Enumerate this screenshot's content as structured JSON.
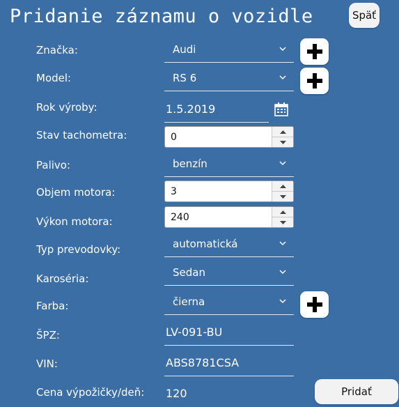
{
  "window": {
    "title": "Pridanie záznamu o vozidle",
    "back_label": "Späť"
  },
  "form": {
    "brand": {
      "label": "Značka:",
      "value": "Audi"
    },
    "model": {
      "label": "Model:",
      "value": "RS 6"
    },
    "year": {
      "label": "Rok výroby:",
      "value": "1.5.2019"
    },
    "odometer": {
      "label": "Stav tachometra:",
      "value": "0"
    },
    "fuel": {
      "label": "Palivo:",
      "value": "benzín"
    },
    "engine_volume": {
      "label": "Objem motora:",
      "value": "3"
    },
    "engine_power": {
      "label": "Výkon motora:",
      "value": "240"
    },
    "transmission": {
      "label": "Typ prevodovky:",
      "value": "automatická"
    },
    "body": {
      "label": "Karoséria:",
      "value": "Sedan"
    },
    "color": {
      "label": "Farba:",
      "value": "čierna"
    },
    "plate": {
      "label": "ŠPZ:",
      "value": "LV-091-BU"
    },
    "vin": {
      "label": "VIN:",
      "value": "ABS8781CSA"
    },
    "price": {
      "label": "Cena výpožičky/deň:",
      "value": "120"
    }
  },
  "actions": {
    "add_label": "Pridať"
  },
  "colors": {
    "background": "#3a6ea5",
    "text": "#ffffff",
    "button_bg": "#f2f2f2"
  }
}
